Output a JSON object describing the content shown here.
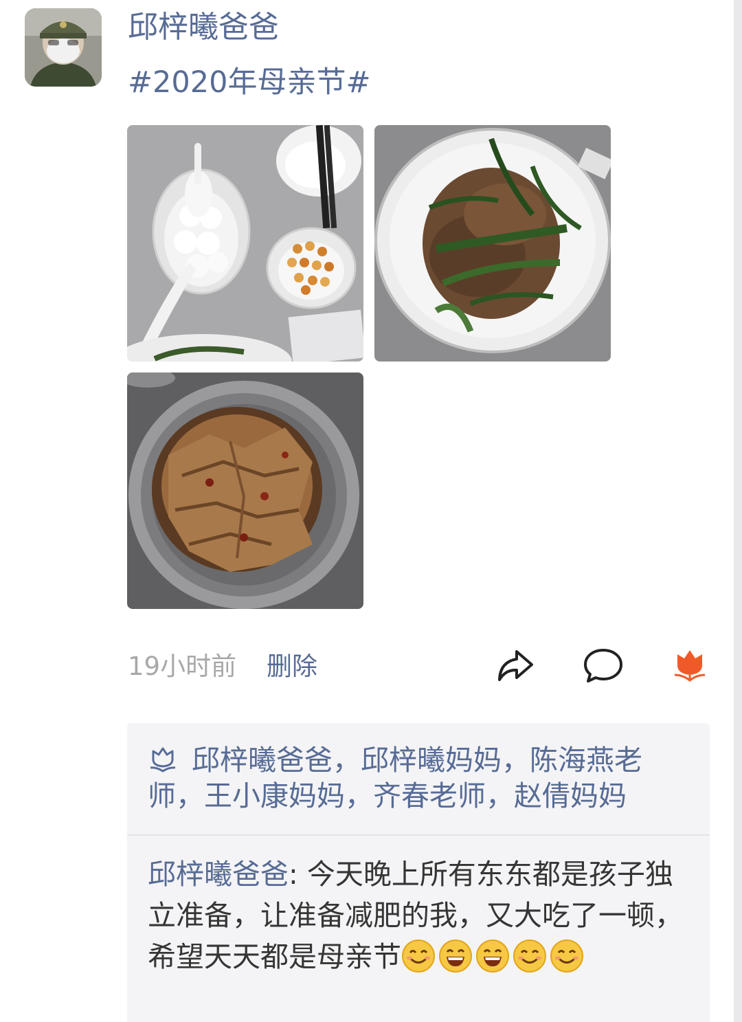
{
  "post": {
    "author": "邱梓曦爸爸",
    "text": "#2020年母亲节#",
    "images": [
      {
        "name": "tangyuan-table-photo"
      },
      {
        "name": "stirfry-plate-photo"
      },
      {
        "name": "braised-bowl-photo"
      }
    ],
    "time": "19小时前",
    "delete_label": "删除"
  },
  "actions": {
    "share_icon": "share-arrow-icon",
    "comment_icon": "comment-bubble-icon",
    "like_icon": "flower-like-icon",
    "like_color": "#f05a28"
  },
  "likes": {
    "icon": "flower-outline-icon",
    "names_text": "邱梓曦爸爸，邱梓曦妈妈，陈海燕老师，王小康妈妈，齐春老师，赵倩妈妈"
  },
  "comments": [
    {
      "author": "邱梓曦爸爸",
      "separator": ": ",
      "text": "今天晚上所有东东都是孩子独立准备，让准备减肥的我，又大吃了一顿，希望天天都是母亲节",
      "emojis": [
        "smile-emoji",
        "grin-emoji",
        "grin-emoji",
        "smile-emoji",
        "smile-emoji"
      ]
    }
  ],
  "colors": {
    "link": "#576b95",
    "meta": "#a8a8a8",
    "panel": "#f4f4f6"
  }
}
